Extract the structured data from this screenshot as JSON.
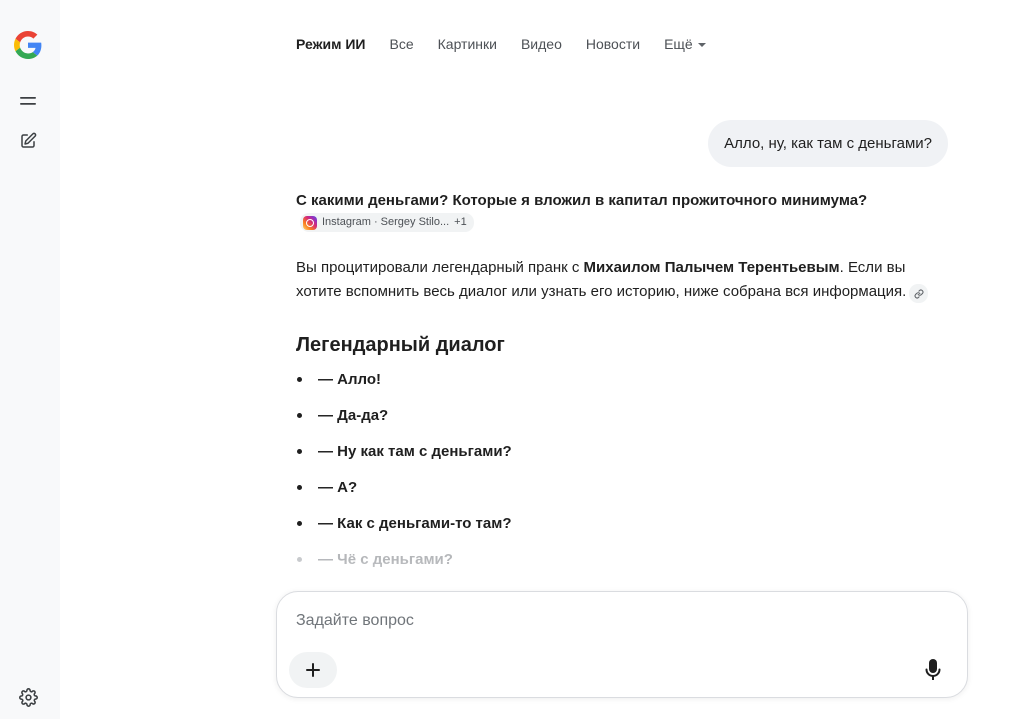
{
  "nav": {
    "tabs": [
      {
        "label": "Режим ИИ",
        "active": true
      },
      {
        "label": "Все"
      },
      {
        "label": "Картинки"
      },
      {
        "label": "Видео"
      },
      {
        "label": "Новости"
      }
    ],
    "more_label": "Ещё"
  },
  "user_message": "Алло, ну, как там с деньгами?",
  "answer": {
    "headline": "С какими деньгами? Которые я вложил в капитал прожиточного минимума?",
    "source_chip": {
      "icon": "instagram-icon",
      "label": "Instagram · Sergey Stilo...",
      "extra": "+1"
    },
    "para_before": "Вы процитировали легендарный пранк с ",
    "para_bold": "Михаилом Палычем Терентьевым",
    "para_after": ". Если вы хотите вспомнить весь диалог или узнать его историю, ниже собрана вся информация.",
    "section_title": "Легендарный диалог",
    "dialog": [
      "— Алло!",
      "— Да-да?",
      "— Ну как там с деньгами?",
      "— А?",
      "— Как с деньгами-то там?",
      "— Чё с деньгами?"
    ]
  },
  "composer": {
    "placeholder": "Задайте вопрос",
    "add_icon": "plus-icon",
    "mic_icon": "mic-icon"
  },
  "colors": {
    "rail_bg": "#f8f9fa",
    "bubble_bg": "#f0f2f5",
    "text": "#1f1f1f",
    "muted": "#4d5156"
  }
}
